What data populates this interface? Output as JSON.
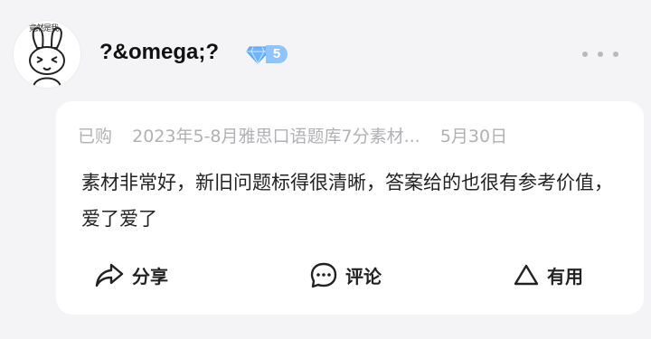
{
  "user": {
    "name": "?&omega;?",
    "avatar_caption": "竟然是我",
    "vip_level": "5"
  },
  "review": {
    "purchase_prefix": "已购",
    "product_title": "2023年5-8月雅思口语题库7分素材...",
    "date": "5月30日",
    "text": "素材非常好，新旧问题标得很清晰，答案给的也很有参考价值，爱了爱了"
  },
  "actions": {
    "share_label": "分享",
    "comment_label": "评论",
    "useful_label": "有用"
  },
  "colors": {
    "background": "#f4f4f6",
    "card": "#ffffff",
    "muted_text": "#b1b1b5",
    "vip_blue": "#8fc4ff"
  },
  "icons": {
    "share": "share-arrow-icon",
    "comment": "chat-bubble-icon",
    "useful": "triangle-thumb-icon",
    "vip": "diamond-icon",
    "more": "more-dots-icon"
  }
}
